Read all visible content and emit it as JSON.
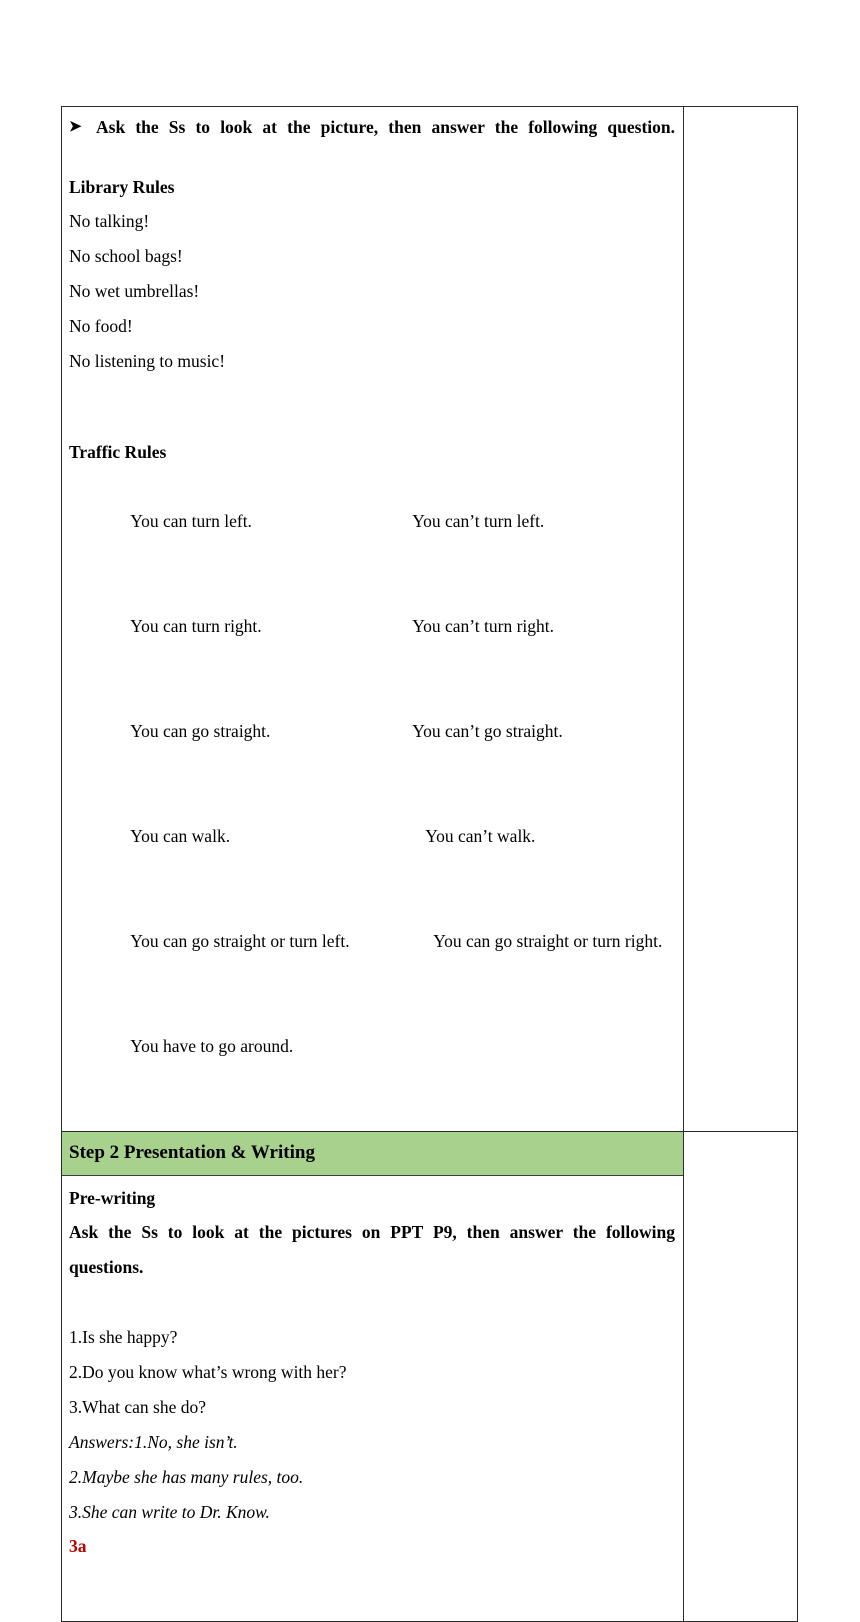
{
  "document": {
    "table": {
      "notes_column_content": ""
    },
    "row1": {
      "bullet_icon": "arrow-bullet-icon",
      "bullet_text": "Ask the Ss to look at the picture, then answer the following question.",
      "library_heading": "Library Rules",
      "library_rules": [
        "No talking!",
        "No school bags!",
        "No wet umbrellas!",
        "No food!",
        "No listening to music!"
      ],
      "traffic_heading": "Traffic Rules",
      "traffic_rules": [
        {
          "left": "You can turn left.",
          "right": "You can’t turn left.",
          "right_indent": 0
        },
        {
          "left": "You can turn right.",
          "right": "You can’t turn right.",
          "right_indent": 0
        },
        {
          "left": "You can go straight.",
          "right": "You can’t go straight.",
          "right_indent": 0
        },
        {
          "left": "You can walk.",
          "right": "You can’t walk.",
          "right_indent": 1
        },
        {
          "left": "You can go straight or turn left.",
          "right": "You can go straight or turn right.",
          "right_indent": 2
        },
        {
          "left": "You have to go around.",
          "right": "",
          "right_indent": 0
        }
      ]
    },
    "row2": {
      "step_banner": "Step 2 Presentation & Writing",
      "banner_color": "#a9d18e",
      "pre_writing_heading": "Pre-writing",
      "instruction": "Ask the Ss to look at the pictures on PPT P9, then answer the following questions.",
      "questions": [
        "1.Is she happy?",
        "2.Do you know what’s wrong with her?",
        "3.What can she do?"
      ],
      "answers": [
        "Answers:1.No, she isn’t.",
        "2.Maybe she has many rules, too.",
        "3.She can write to Dr. Know."
      ],
      "section_label": "3a",
      "section_label_color": "#c00000"
    }
  }
}
